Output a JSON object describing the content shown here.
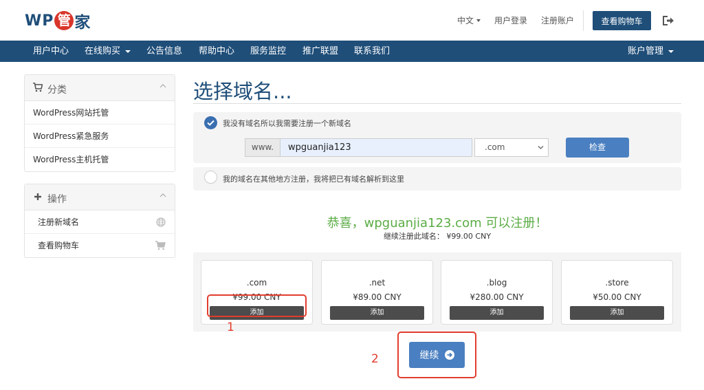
{
  "logo": {
    "wp": "WP",
    "guan": "管",
    "jia": "家"
  },
  "topnav": {
    "language": "中文",
    "login": "用户登录",
    "register": "注册账户",
    "view_cart": "查看购物车"
  },
  "navbar": {
    "items": [
      "用户中心",
      "在线购买",
      "公告信息",
      "帮助中心",
      "服务监控",
      "推广联盟",
      "联系我们"
    ],
    "account": "账户管理"
  },
  "sidebar": {
    "categories": {
      "title": "分类",
      "items": [
        "WordPress网站托管",
        "WordPress紧急服务",
        "WordPress主机托管"
      ]
    },
    "actions": {
      "title": "操作",
      "items": [
        "注册新域名",
        "查看购物车"
      ]
    }
  },
  "main": {
    "title": "选择域名...",
    "option_register": "我没有域名所以我需要注册一个新域名",
    "www_prefix": "www.",
    "domain_value": "wpguanjia123",
    "tld_selected": ".com",
    "check_button": "检查",
    "option_transfer": "我的域名在其他地方注册，我将把已有域名解析到这里",
    "congrats": "恭喜，wpguanjia123.com 可以注册！",
    "price_line": "继续注册此域名：  ¥99.00 CNY",
    "tlds": [
      {
        "name": ".com",
        "price": "¥99.00 CNY",
        "button": "添加"
      },
      {
        "name": ".net",
        "price": "¥89.00 CNY",
        "button": "添加"
      },
      {
        "name": ".blog",
        "price": "¥280.00 CNY",
        "button": "添加"
      },
      {
        "name": ".store",
        "price": "¥50.00 CNY",
        "button": "添加"
      }
    ],
    "continue_button": "继续"
  },
  "annotations": {
    "step1": "1",
    "step2": "2",
    "color": "#e23d2e"
  },
  "colors": {
    "brand": "#1f4e79",
    "accent": "#4a7fc1",
    "success": "#5aac44",
    "logo_red": "#d9362b"
  },
  "icons": [
    "cart-icon",
    "plus-icon",
    "chevron-up-icon",
    "globe-icon",
    "shopping-cart-icon",
    "check-icon",
    "logout-icon",
    "arrow-right-circle-icon"
  ]
}
